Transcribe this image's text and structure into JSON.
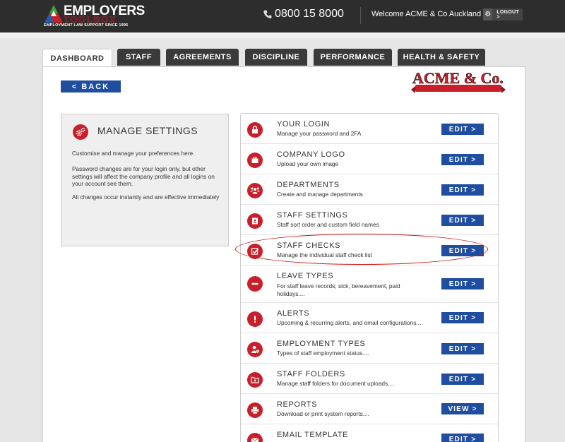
{
  "header": {
    "logo": {
      "main": "EMPLOYERS",
      "sub": "TOOLBOX",
      "tagline": "EMPLOYMENT LAW SUPPORT SINCE 1995"
    },
    "phone": "0800 15 8000",
    "phone_icon": "phone-icon",
    "welcome": "Welcome ACME & Co Auckland",
    "logout_label": "LOGOUT >",
    "settings_icon": "gear-icon"
  },
  "tabs": [
    {
      "label": "DASHBOARD",
      "active": true
    },
    {
      "label": "STAFF"
    },
    {
      "label": "AGREEMENTS"
    },
    {
      "label": "DISCIPLINE"
    },
    {
      "label": "PERFORMANCE"
    },
    {
      "label": "HEALTH & SAFETY"
    }
  ],
  "back_label": "<  BACK",
  "company_logo_text": "ACME & Co.",
  "sidebar": {
    "title": "MANAGE SETTINGS",
    "icon": "gears-icon",
    "paragraphs": [
      "Customise and manage your preferences here.",
      "Password changes are for your login only, but other settings will affect the company profile and all logins on your account see them.",
      "All changes occur instantly and are effective immediately"
    ]
  },
  "settings": [
    {
      "title": "YOUR LOGIN",
      "desc": "Manage your password and 2FA",
      "button": "EDIT >",
      "icon": "lock-icon"
    },
    {
      "title": "COMPANY LOGO",
      "desc": "Upload your own image",
      "button": "EDIT >",
      "icon": "briefcase-icon"
    },
    {
      "title": "DEPARTMENTS",
      "desc": "Create and manage departments",
      "button": "EDIT >",
      "icon": "group-icon"
    },
    {
      "title": "STAFF SETTINGS",
      "desc": "Staff sort order and custom field names",
      "button": "EDIT >",
      "icon": "user-card-icon"
    },
    {
      "title": "STAFF CHECKS",
      "desc": "Manage the individual staff check list",
      "button": "EDIT >",
      "icon": "checkbox-icon"
    },
    {
      "title": "LEAVE TYPES",
      "desc": "For staff leave records; sick, bereavement, paid holidays....",
      "button": "EDIT >",
      "icon": "minus-icon"
    },
    {
      "title": "ALERTS",
      "desc": "Upcoming & recurring alerts, and email configurations....",
      "button": "EDIT >",
      "icon": "alert-icon"
    },
    {
      "title": "EMPLOYMENT TYPES",
      "desc": "Types of staff employment status....",
      "button": "EDIT >",
      "icon": "user-clock-icon"
    },
    {
      "title": "STAFF FOLDERS",
      "desc": "Manage staff folders for document uploads....",
      "button": "EDIT >",
      "icon": "folder-icon"
    },
    {
      "title": "REPORTS",
      "desc": "Download or print system reports....",
      "button": "VIEW >",
      "icon": "printer-icon"
    },
    {
      "title": "EMAIL TEMPLATE",
      "desc": "",
      "button": "EDIT >",
      "icon": "email-icon"
    }
  ]
}
